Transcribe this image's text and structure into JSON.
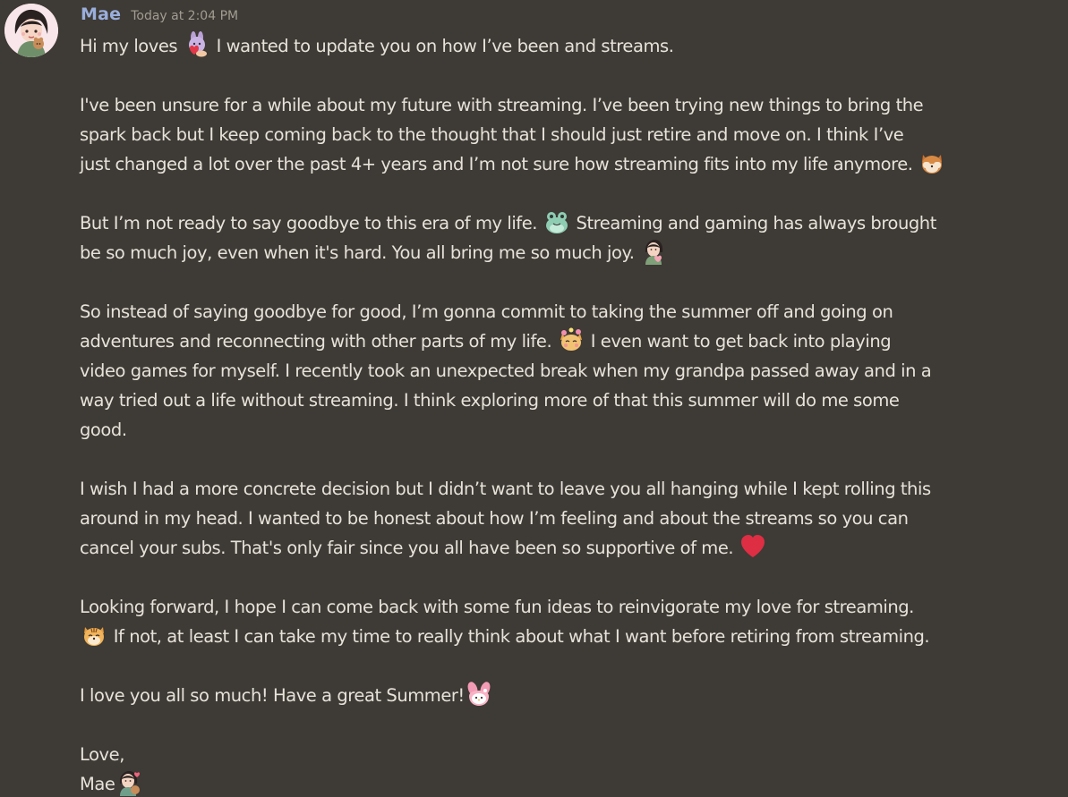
{
  "message": {
    "author": "Mae",
    "timestamp": "Today at 2:04 PM",
    "paragraphs": [
      {
        "lines": [
          {
            "segments": [
              "Hi my loves ",
              " I wanted to update you on how I’ve been and streams."
            ]
          }
        ]
      },
      {
        "lines": [
          {
            "segments": [
              "I've been unsure for a while about my future with streaming. I’ve been trying new things to bring the"
            ]
          },
          {
            "segments": [
              "spark back but I keep coming back to the thought that I should just retire and move on. I think I’ve"
            ]
          },
          {
            "segments": [
              "just changed a lot over the past 4+ years and I’m not sure how streaming fits into my life anymore. "
            ]
          }
        ]
      },
      {
        "lines": [
          {
            "segments": [
              "But I’m not ready to say goodbye to this era of my life. ",
              "  Streaming and gaming has always brought"
            ]
          },
          {
            "segments": [
              "be so much joy, even when it's hard. You all bring me so much joy. "
            ]
          }
        ]
      },
      {
        "lines": [
          {
            "segments": [
              "So instead of saying goodbye for good, I’m gonna commit to taking the summer off and going on"
            ]
          },
          {
            "segments": [
              "adventures and reconnecting with other parts of my life. ",
              "  I even want to get back into playing"
            ]
          },
          {
            "segments": [
              "video games for myself. I recently took an unexpected break when my grandpa passed away and in a"
            ]
          },
          {
            "segments": [
              "way tried out a life without streaming. I think exploring more of that this summer will do me some"
            ]
          },
          {
            "segments": [
              "good."
            ]
          }
        ]
      },
      {
        "lines": [
          {
            "segments": [
              "I wish I had a more concrete decision but I didn’t want to leave you all hanging while I kept rolling this"
            ]
          },
          {
            "segments": [
              "around in my head. I wanted to be honest about how I’m feeling and about the streams so you can"
            ]
          },
          {
            "segments": [
              "cancel your subs. That's only fair since you all have been so supportive of me. "
            ]
          }
        ]
      },
      {
        "lines": [
          {
            "segments": [
              "Looking forward, I hope I can come back with some fun ideas to reinvigorate my love for streaming."
            ]
          },
          {
            "segments": [
              "",
              "  If not, at least I can take my time to really think about what I want before retiring from streaming."
            ]
          }
        ]
      },
      {
        "lines": [
          {
            "segments": [
              "I love you all so much! Have a great Summer!"
            ]
          }
        ]
      },
      {
        "lines": [
          {
            "segments": [
              "Love,"
            ]
          },
          {
            "segments": [
              "Mae"
            ]
          }
        ]
      }
    ],
    "emojis": {
      "p0": "bunny-heart-emoji",
      "p1": "shy-dog-emoji",
      "p2a": "frog-emoji",
      "p2b": "girl-heart-emoji",
      "p3": "flower-cat-emoji",
      "p4": "red-heart-emoji",
      "p5": "tiger-cat-emoji",
      "p6": "my-melody-emoji",
      "p7": "mae-heart-emoji"
    }
  }
}
